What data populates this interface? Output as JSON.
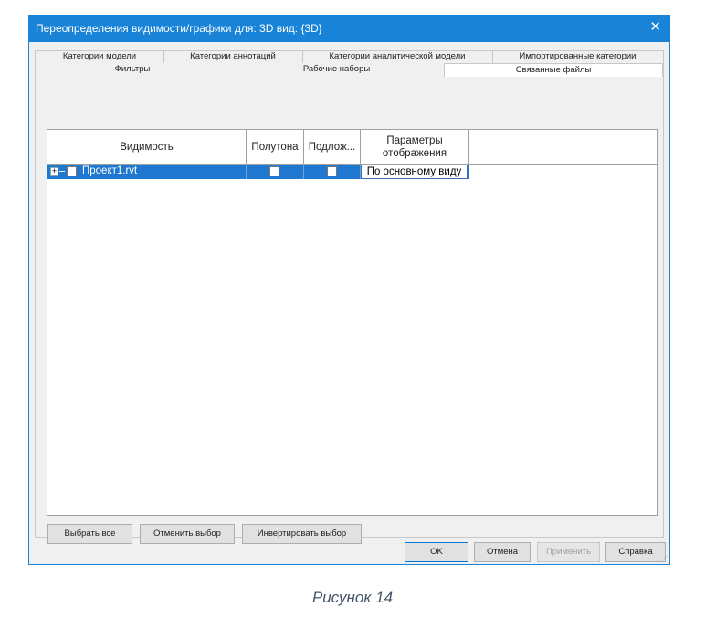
{
  "dialog": {
    "title": "Переопределения видимости/графики для: 3D вид: {3D}",
    "close_glyph": "✕"
  },
  "tabs": {
    "row1": [
      "Категории модели",
      "Категории аннотаций",
      "Категории аналитической модели",
      "Импортированные категории"
    ],
    "row2": [
      "Фильтры",
      "Рабочие наборы",
      "Связанные файлы"
    ],
    "active": "Связанные файлы"
  },
  "grid": {
    "columns": [
      "Видимость",
      "Полутона",
      "Подлож...",
      "Параметры отображения"
    ],
    "rows": [
      {
        "name": "Проект1.rvt",
        "visible": false,
        "halftone": false,
        "underlay": false,
        "display": "По основному виду"
      }
    ]
  },
  "buttons": {
    "select_all": "Выбрать все",
    "deselect": "Отменить выбор",
    "invert": "Инвертировать выбор",
    "ok": "OK",
    "cancel": "Отмена",
    "apply": "Применить",
    "help": "Справка"
  },
  "caption": "Рисунок 14",
  "colors": {
    "titlebar": "#1883d7",
    "selection": "#1f77d0"
  }
}
